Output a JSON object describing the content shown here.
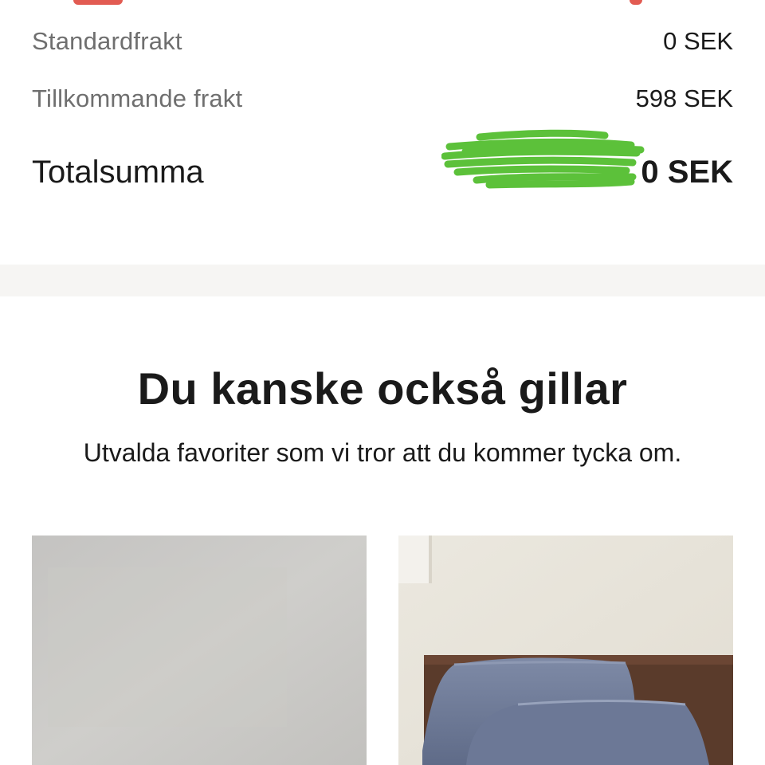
{
  "summary": {
    "standard_shipping": {
      "label": "Standardfrakt",
      "value": "0 SEK"
    },
    "additional_shipping": {
      "label": "Tillkommande frakt",
      "value": "598 SEK"
    },
    "total": {
      "label": "Totalsumma",
      "value": "0 SEK"
    }
  },
  "recommendations": {
    "title": "Du kanske också gillar",
    "subtitle": "Utvalda favoriter som vi tror att du kommer tycka om."
  },
  "colors": {
    "text": "#1a1a1a",
    "muted": "#6f6f6f",
    "band": "#f6f5f3",
    "scribble": "#5cc13a",
    "top_red": "#e25b52"
  }
}
